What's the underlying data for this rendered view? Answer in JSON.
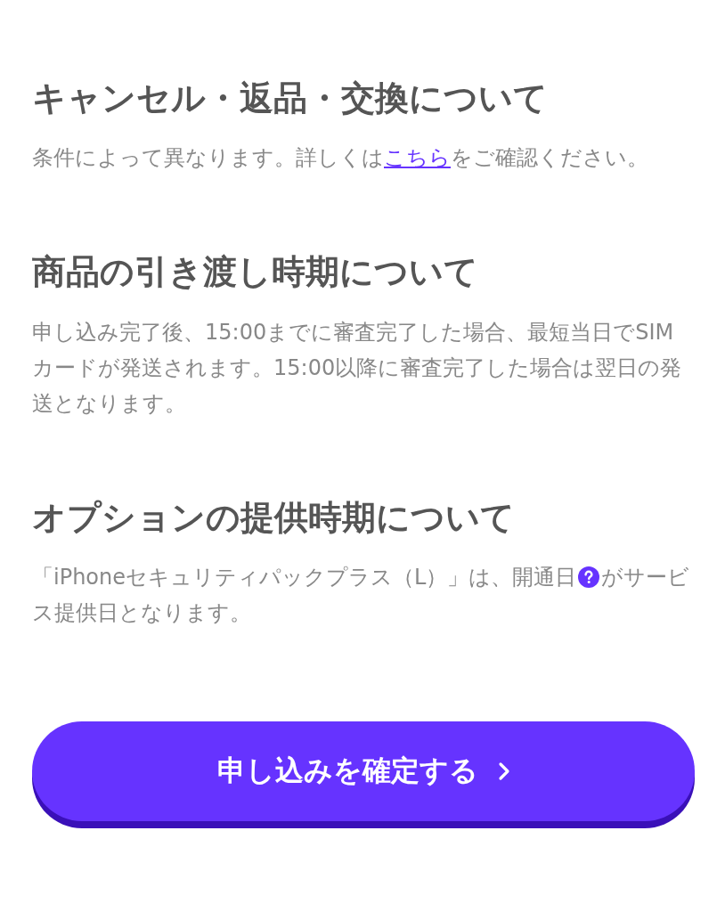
{
  "sections": [
    {
      "title": "キャンセル・返品・交換について",
      "body": {
        "before": "条件によって異なります。詳しくは",
        "link": "こちら",
        "after": "をご確認ください。"
      }
    },
    {
      "title": "商品の引き渡し時期について",
      "body": {
        "before": "申し込み完了後、15:00までに審査完了した場合、最短当日でSIMカードが発送されます。15:00以降に審査完了した場合は翌日の発送となります。"
      }
    },
    {
      "title": "オプションの提供時期について",
      "body": {
        "before": "「iPhoneセキュリティパックプラス（L）」は、開通日",
        "help": true,
        "after": "がサービス提供日となります。"
      }
    }
  ],
  "button": {
    "label": "申し込みを確定する"
  }
}
